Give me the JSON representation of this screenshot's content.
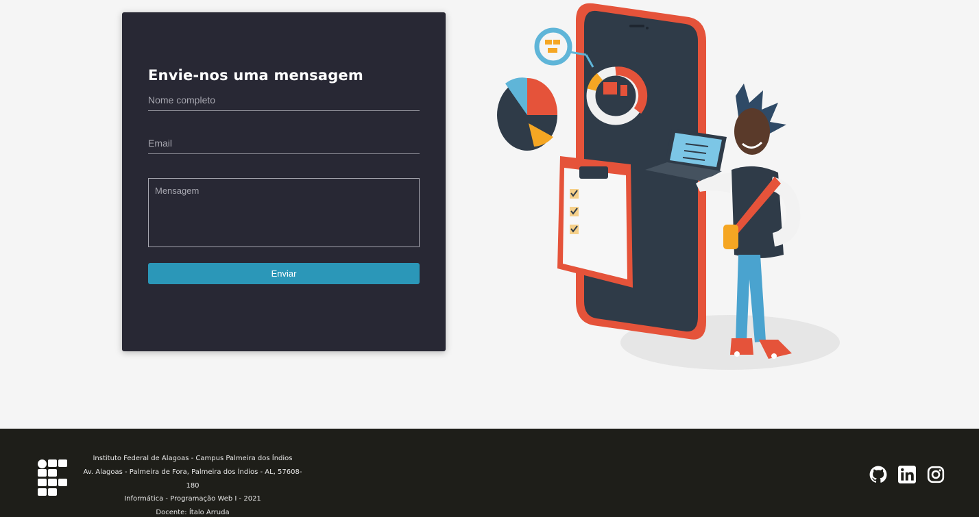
{
  "form": {
    "title": "Envie-nos uma mensagem",
    "name_placeholder": "Nome completo",
    "email_placeholder": "Email",
    "message_placeholder": "Mensagem",
    "submit_label": "Enviar"
  },
  "illustration": {
    "icon": "person-with-laptop-and-smartphone-illustration"
  },
  "footer": {
    "logo_icon": "ifal-logo-icon",
    "lines": [
      "Instituto Federal de Alagoas - Campus Palmeira dos Índios",
      "Av. Alagoas - Palmeira de Fora, Palmeira dos Índios - AL, 57608-180",
      "Informática - Programação Web I - 2021",
      "Docente: Ítalo Arruda"
    ],
    "social": [
      {
        "icon": "github-icon"
      },
      {
        "icon": "linkedin-icon"
      },
      {
        "icon": "instagram-icon"
      }
    ]
  },
  "colors": {
    "card_bg": "#282834",
    "button": "#2b97b8",
    "footer_bg": "#1e1e19",
    "page_bg": "#f5f5f5"
  }
}
